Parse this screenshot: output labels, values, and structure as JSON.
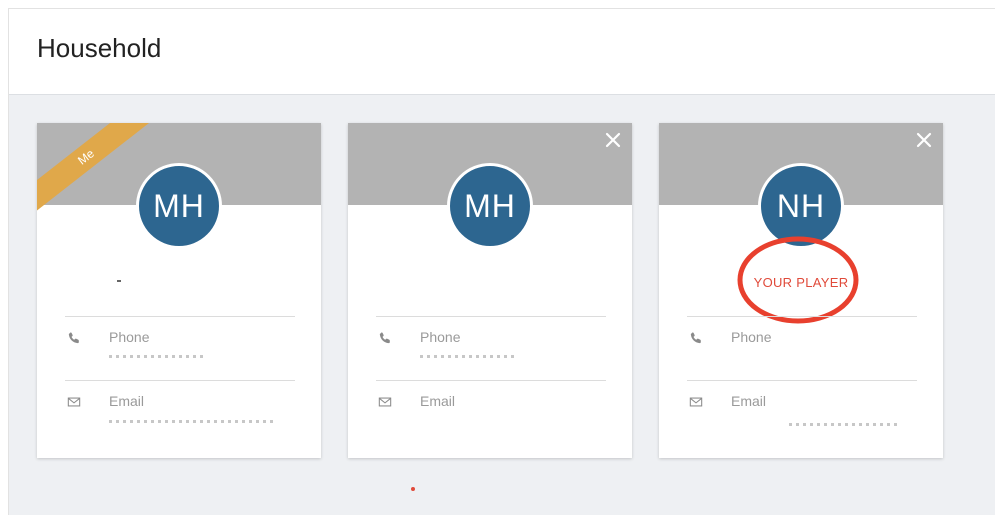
{
  "page": {
    "title": "Household"
  },
  "colors": {
    "avatar_bg": "#2d6690",
    "banner_bg": "#b3b3b3",
    "ribbon_bg": "#e0a84a",
    "annotation_red": "#e04a3a"
  },
  "cards": [
    {
      "ribbon": "Me",
      "initials": "MH",
      "phone_label": "Phone",
      "email_label": "Email",
      "closable": false
    },
    {
      "initials": "MH",
      "phone_label": "Phone",
      "email_label": "Email",
      "closable": true
    },
    {
      "initials": "NH",
      "tag": "YOUR PLAYER",
      "phone_label": "Phone",
      "email_label": "Email",
      "closable": true
    }
  ],
  "icons": {
    "close": "close-icon",
    "phone": "phone-icon",
    "email": "envelope-icon"
  }
}
